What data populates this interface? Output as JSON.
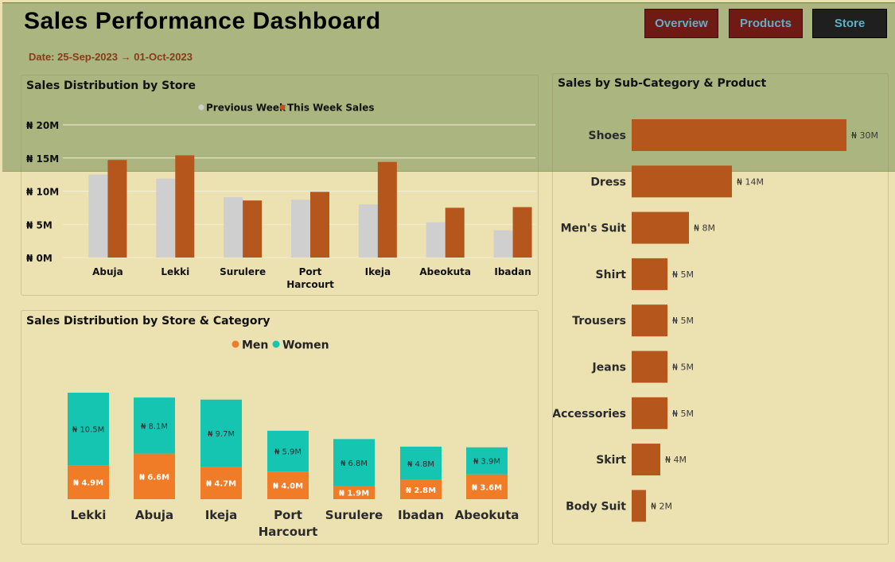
{
  "header": {
    "title": "Sales Performance Dashboard",
    "date_range": "Date: 25-Sep-2023 → 01-Oct-2023",
    "buttons": {
      "overview": "Overview",
      "products": "Products",
      "store": "Store"
    }
  },
  "colors": {
    "header_band": "#abb57f",
    "page_bg": "#ece1b1",
    "previous_week": "#cfcfcf",
    "this_week": "#b5571d",
    "men": "#f07c28",
    "women": "#15c5b2",
    "product_bar": "#b5571d",
    "nav_red": "#6f1a14",
    "nav_dark": "#1f1f1f",
    "nav_text": "#5fb0c4"
  },
  "chart_data": [
    {
      "id": "store",
      "type": "bar",
      "title": "Sales Distribution by Store",
      "categories": [
        "Abuja",
        "Lekki",
        "Surulere",
        "Port Harcourt",
        "Ikeja",
        "Abeokuta",
        "Ibadan"
      ],
      "series": [
        {
          "name": "Previous Week",
          "values": [
            12.5,
            11.9,
            9.1,
            8.7,
            8.0,
            5.3,
            4.1
          ]
        },
        {
          "name": "This Week Sales",
          "values": [
            14.7,
            15.4,
            8.6,
            9.9,
            14.4,
            7.5,
            7.6
          ]
        }
      ],
      "ylim": [
        0,
        20
      ],
      "yticks": [
        0,
        5,
        10,
        15,
        20
      ],
      "ytick_labels": [
        "₦ 0M",
        "₦ 5M",
        "₦ 10M",
        "₦ 15M",
        "₦ 20M"
      ],
      "grid": true,
      "legend": "top-center"
    },
    {
      "id": "category",
      "type": "bar",
      "stacked": true,
      "title": "Sales Distribution by Store & Category",
      "categories": [
        "Lekki",
        "Abuja",
        "Ikeja",
        "Port Harcourt",
        "Surulere",
        "Ibadan",
        "Abeokuta"
      ],
      "series": [
        {
          "name": "Men",
          "values": [
            4.9,
            6.6,
            4.7,
            4.0,
            1.9,
            2.8,
            3.6
          ],
          "labels": [
            "₦ 4.9M",
            "₦ 6.6M",
            "₦ 4.7M",
            "₦ 4.0M",
            "₦ 1.9M",
            "₦ 2.8M",
            "₦ 3.6M"
          ]
        },
        {
          "name": "Women",
          "values": [
            10.5,
            8.1,
            9.7,
            5.9,
            6.8,
            4.8,
            3.9
          ],
          "labels": [
            "₦ 10.5M",
            "₦ 8.1M",
            "₦ 9.7M",
            "₦ 5.9M",
            "₦ 6.8M",
            "₦ 4.8M",
            "₦ 3.9M"
          ]
        }
      ],
      "legend": "top-center"
    },
    {
      "id": "product",
      "type": "bar",
      "orientation": "horizontal",
      "title": "Sales by Sub-Category & Product",
      "categories": [
        "Shoes",
        "Dress",
        "Men's Suit",
        "Shirt",
        "Trousers",
        "Jeans",
        "Accessories",
        "Skirt",
        "Body Suit"
      ],
      "values": [
        30,
        14,
        8,
        5,
        5,
        5,
        5,
        4,
        2
      ],
      "labels": [
        "₦ 30M",
        "₦ 14M",
        "₦ 8M",
        "₦ 5M",
        "₦ 5M",
        "₦ 5M",
        "₦ 5M",
        "₦ 4M",
        "₦ 2M"
      ]
    }
  ]
}
